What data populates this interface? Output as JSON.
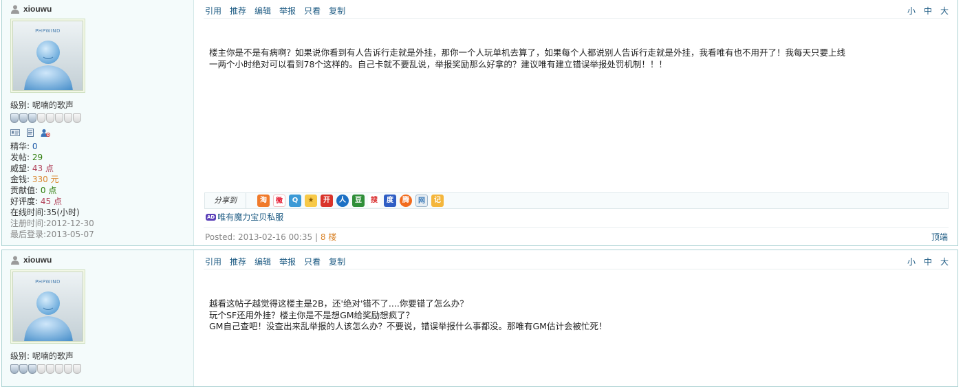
{
  "posts": [
    {
      "username": "xiouwu",
      "avatar_brand": "PHPWIND",
      "level_label": "级别:",
      "level_value": "呢喃的歌声",
      "medals_lit": 3,
      "medals_total": 8,
      "actions": [
        "引用",
        "推荐",
        "编辑",
        "举报",
        "只看",
        "复制"
      ],
      "font_sizes": [
        "小",
        "中",
        "大"
      ],
      "stats": [
        {
          "label": "精华:",
          "value": "0"
        },
        {
          "label": "发帖:",
          "value": "29"
        },
        {
          "label": "威望:",
          "value": "43 点"
        },
        {
          "label": "金钱:",
          "value": "330 元"
        },
        {
          "label": "贡献值:",
          "value": "0 点"
        },
        {
          "label": "好评度:",
          "value": "45 点"
        },
        {
          "label": "在线时间:",
          "value": "35(小时)"
        },
        {
          "label": "注册时间:",
          "value": "2012-12-30"
        },
        {
          "label": "最后登录:",
          "value": "2013-05-07"
        }
      ],
      "content_lines": [
        "楼主你是不是有病啊？如果说你看到有人告诉行走就是外挂，那你一个人玩单机去算了，如果每个人都说别人告诉行走就是外挂，我看唯有也不用开了！我每天只要上线",
        "一两个小时绝对可以看到78个这样的。自己卡就不要乱说，举报奖励那么好拿的？建议唯有建立错误举报处罚机制！！！"
      ],
      "share_label": "分享到",
      "share_icons": [
        "taobao-icon",
        "weibo-icon",
        "qzone-icon",
        "qq-favorites-icon",
        "kaixin-icon",
        "renren-icon",
        "douban-icon",
        "sohu-icon",
        "baidu-icon",
        "tencent-weibo-icon",
        "netease-icon",
        "163-note-icon"
      ],
      "ad_badge": "AD",
      "ad_text": "唯有魔力宝贝私服",
      "posted_text": "Posted: 2013-02-16 00:35",
      "separator": "|",
      "floor": "8 楼",
      "top_link": "顶端"
    },
    {
      "username": "xiouwu",
      "avatar_brand": "PHPWIND",
      "level_label": "级别:",
      "level_value": "呢喃的歌声",
      "actions": [
        "引用",
        "推荐",
        "编辑",
        "举报",
        "只看",
        "复制"
      ],
      "font_sizes": [
        "小",
        "中",
        "大"
      ],
      "content_lines": [
        "越看这帖子越觉得这楼主是2B，还'绝对'错不了....你要错了怎么办？",
        "玩个SF还用外挂？楼主你是不是想GM给奖励想疯了？",
        "GM自己查吧！没查出来乱举报的人该怎么办？不要说，错误举报什么事都没。那唯有GM估计会被忙死！"
      ]
    }
  ],
  "colors": {
    "border": "#a9d1d2",
    "sidebar_bg": "#f4fbfb",
    "link": "#1f5c84",
    "floor": "#d9842b"
  }
}
